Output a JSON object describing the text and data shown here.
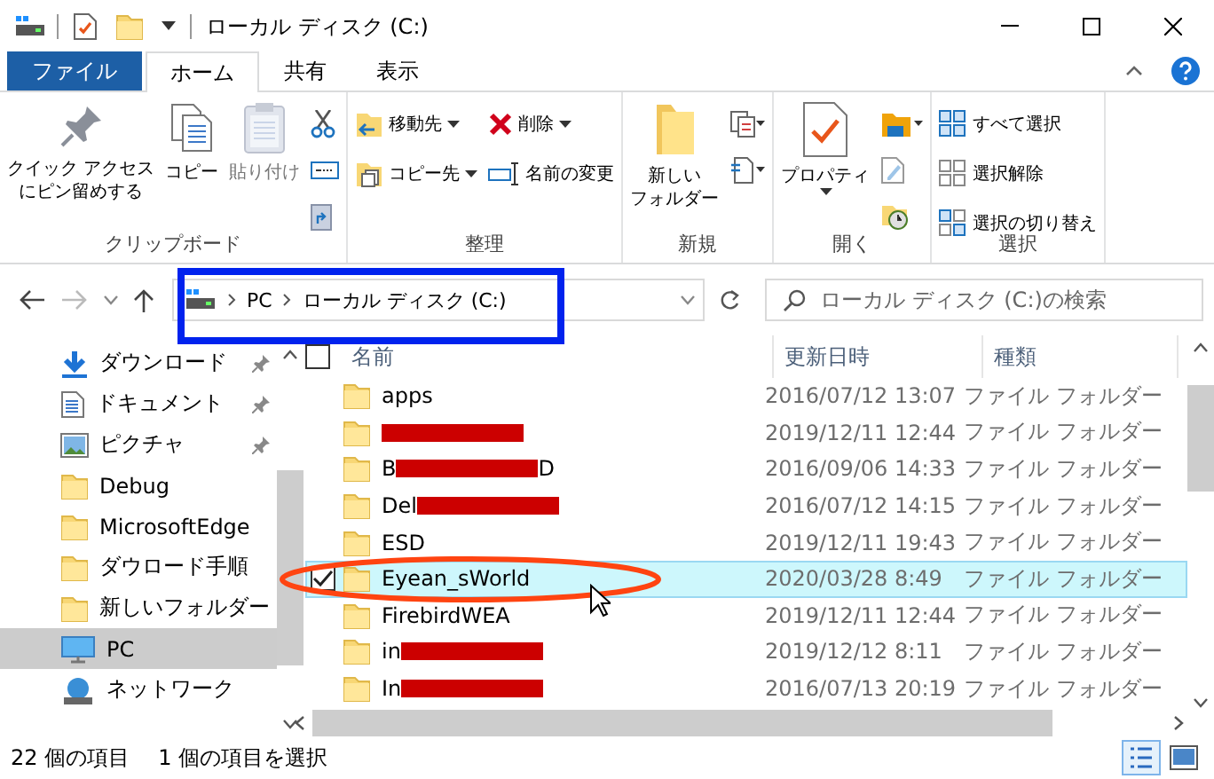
{
  "window": {
    "title": "ローカル ディスク (C:)"
  },
  "ribbon_tabs": [
    {
      "label": "ファイル",
      "kind": "file",
      "selected": false
    },
    {
      "label": "ホーム",
      "kind": "tab",
      "selected": true
    },
    {
      "label": "共有",
      "kind": "tab",
      "selected": false
    },
    {
      "label": "表示",
      "kind": "tab",
      "selected": false
    }
  ],
  "ribbon_groups": [
    {
      "label": "クリップボード",
      "items": [
        {
          "label": [
            "クイック アクセス",
            "にピン留めする"
          ],
          "kind": "large",
          "has_menu": false,
          "disabled": false
        },
        {
          "label": [
            "コピー"
          ],
          "kind": "large",
          "has_menu": false,
          "disabled": false
        },
        {
          "label": [
            "貼り付け"
          ],
          "kind": "large",
          "has_menu": false,
          "disabled": true
        }
      ]
    },
    {
      "label": "整理",
      "items": [
        {
          "label": "移動先",
          "kind": "small",
          "has_menu": true,
          "disabled": false
        },
        {
          "label": "コピー先",
          "kind": "small",
          "has_menu": true,
          "disabled": false
        },
        {
          "label": "削除",
          "kind": "small",
          "has_menu": true,
          "disabled": false
        },
        {
          "label": "名前の変更",
          "kind": "small",
          "has_menu": false,
          "disabled": false
        }
      ]
    },
    {
      "label": "新規",
      "items": [
        {
          "label": [
            "新しい",
            "フォルダー"
          ],
          "kind": "large",
          "has_menu": false,
          "disabled": false
        }
      ]
    },
    {
      "label": "開く",
      "items": [
        {
          "label": [
            "プロパティ"
          ],
          "kind": "large",
          "has_menu": true,
          "disabled": false
        }
      ]
    },
    {
      "label": "選択",
      "items": [
        {
          "label": "すべて選択",
          "kind": "small",
          "has_menu": false,
          "disabled": false
        },
        {
          "label": "選択解除",
          "kind": "small",
          "has_menu": false,
          "disabled": false
        },
        {
          "label": "選択の切り替え",
          "kind": "small",
          "has_menu": false,
          "disabled": false
        }
      ]
    }
  ],
  "address": {
    "breadcrumbs": [
      "PC",
      "ローカル ディスク (C:)"
    ]
  },
  "search": {
    "placeholder": "ローカル ディスク (C:)の検索"
  },
  "navigation": [
    {
      "label": "ダウンロード",
      "kind": "download",
      "pinned": true,
      "selected": false
    },
    {
      "label": "ドキュメント",
      "kind": "document",
      "pinned": true,
      "selected": false
    },
    {
      "label": "ピクチャ",
      "kind": "picture",
      "pinned": true,
      "selected": false
    },
    {
      "label": "Debug",
      "kind": "folder",
      "pinned": false,
      "selected": false
    },
    {
      "label": "MicrosoftEdge",
      "kind": "folder",
      "pinned": false,
      "selected": false
    },
    {
      "label": "ダウロード手順",
      "kind": "folder",
      "pinned": false,
      "selected": false
    },
    {
      "label": "新しいフォルダー",
      "kind": "folder",
      "pinned": false,
      "selected": false
    },
    {
      "label": "PC",
      "kind": "pc",
      "pinned": false,
      "selected": true
    },
    {
      "label": "ネットワーク",
      "kind": "network",
      "pinned": false,
      "selected": false
    }
  ],
  "table": {
    "select_all_checked": false,
    "columns": [
      "名前",
      "更新日時",
      "種類"
    ],
    "rows": [
      {
        "name": "apps",
        "redacted": false,
        "modified": "2016/07/12 13:07",
        "type": "ファイル フォルダー",
        "selected": false
      },
      {
        "redacted": true,
        "modified": "2019/12/11 12:44",
        "type": "ファイル フォルダー",
        "selected": false
      },
      {
        "name": "B",
        "redacted": true,
        "name_end": "D",
        "modified": "2016/09/06 14:33",
        "type": "ファイル フォルダー",
        "selected": false
      },
      {
        "name": "Del",
        "redacted": true,
        "modified": "2016/07/12 14:15",
        "type": "ファイル フォルダー",
        "selected": false
      },
      {
        "name": "ESD",
        "redacted": false,
        "modified": "2019/12/11 19:43",
        "type": "ファイル フォルダー",
        "selected": false
      },
      {
        "name": "Eyean_sWorld",
        "redacted": false,
        "modified": "2020/03/28 8:49",
        "type": "ファイル フォルダー",
        "selected": true
      },
      {
        "name": "FirebirdWEA",
        "redacted": false,
        "modified": "2019/12/11 12:44",
        "type": "ファイル フォルダー",
        "selected": false
      },
      {
        "name": "in",
        "redacted": true,
        "modified": "2019/12/12 8:11",
        "type": "ファイル フォルダー",
        "selected": false
      },
      {
        "name": "In",
        "redacted": true,
        "modified": "2016/07/13 20:19",
        "type": "ファイル フォルダー",
        "selected": false
      }
    ]
  },
  "status_bar": {
    "item_count": "22 個の項目",
    "selection": "1 個の項目を選択"
  },
  "view_buttons": [
    {
      "kind": "details",
      "selected": true
    },
    {
      "kind": "large_icons",
      "selected": false
    }
  ],
  "annotations": [
    {
      "kind": "rectangle",
      "color": "#0022ee"
    },
    {
      "kind": "ellipse",
      "color": "#ff4411"
    }
  ]
}
